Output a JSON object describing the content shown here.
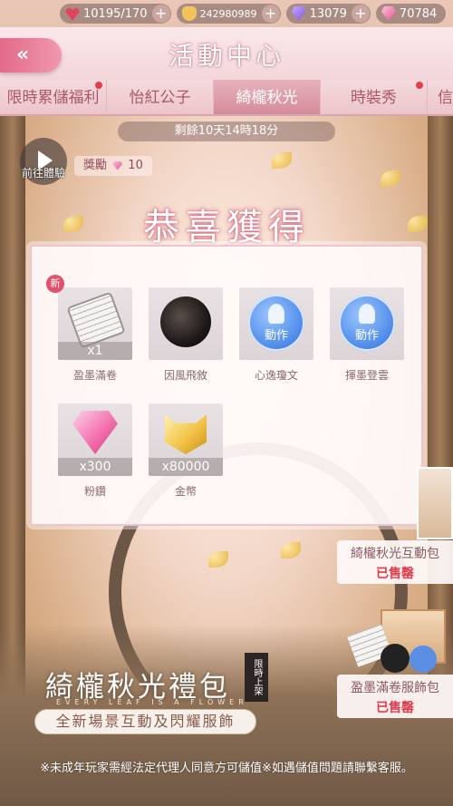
{
  "status_bar": {
    "stamina": "10195/170",
    "coins": "242980989",
    "purple_diamonds": "13079",
    "pink_diamonds": "70784"
  },
  "header": {
    "title": "活動中心"
  },
  "tabs": [
    {
      "label": "限時累儲福利",
      "active": false,
      "dot": true
    },
    {
      "label": "怡紅公子",
      "active": false,
      "dot": false
    },
    {
      "label": "綺櫳秋光",
      "active": true,
      "dot": false
    },
    {
      "label": "時裝秀",
      "active": false,
      "dot": true
    },
    {
      "label": "信",
      "active": false,
      "dot": false
    }
  ],
  "event": {
    "countdown": "剩餘10天14時18分",
    "trial_label": "前往體驗",
    "reward_label": "獎勵",
    "reward_value": "10"
  },
  "dialog": {
    "title": "恭喜獲得",
    "new_badge": "新",
    "items": [
      {
        "name": "盈墨滿卷",
        "qty": "x1"
      },
      {
        "name": "因風飛敘",
        "qty": ""
      },
      {
        "name": "心逸瓊文",
        "qty": "",
        "tag": "動作"
      },
      {
        "name": "揮墨登雲",
        "qty": "",
        "tag": "動作"
      },
      {
        "name": "粉鑽",
        "qty": "x300"
      },
      {
        "name": "金幣",
        "qty": "x80000"
      }
    ]
  },
  "packages": [
    {
      "name": "綺櫳秋光互動包",
      "status": "已售罄"
    },
    {
      "name": "盈墨滿卷服飾包",
      "status": "已售罄"
    }
  ],
  "banner": {
    "title": "綺櫳秋光禮包",
    "subtitle_en": "EVERY LEAF IS A FLOWER",
    "seal": "限時上架",
    "tag": "全新場景互動及閃耀服飾"
  },
  "disclaimer": "※未成年玩家需經法定代理人同意方可儲值※如遇儲值問題請聯繫客服。"
}
